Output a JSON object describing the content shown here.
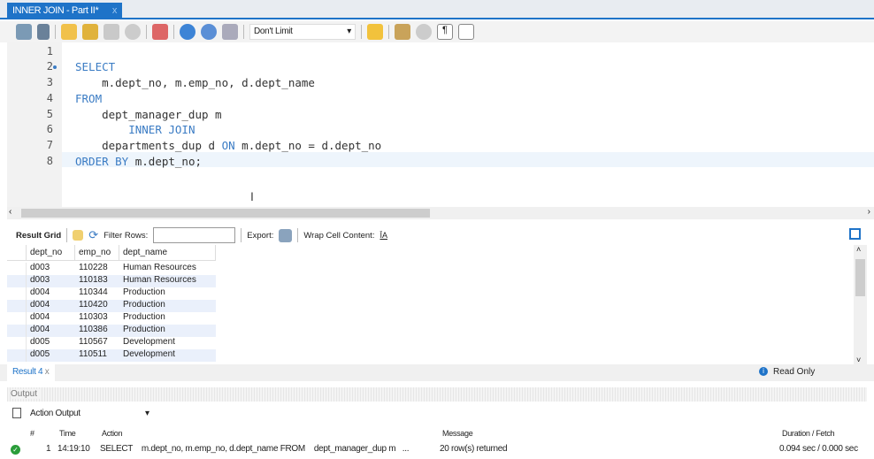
{
  "tab": {
    "title": "INNER JOIN - Part II*",
    "close": "x"
  },
  "toolbar": {
    "limit": "Don't Limit"
  },
  "editor": {
    "lines": [
      "1",
      "2",
      "3",
      "4",
      "5",
      "6",
      "7",
      "8"
    ]
  },
  "results": {
    "result_grid": "Result Grid",
    "filter_rows": "Filter Rows:",
    "export": "Export:",
    "wrap": "Wrap Cell Content:",
    "columns": [
      "dept_no",
      "emp_no",
      "dept_name"
    ],
    "rows": [
      [
        "d003",
        "110228",
        "Human Resources"
      ],
      [
        "d003",
        "110183",
        "Human Resources"
      ],
      [
        "d004",
        "110344",
        "Production"
      ],
      [
        "d004",
        "110420",
        "Production"
      ],
      [
        "d004",
        "110303",
        "Production"
      ],
      [
        "d004",
        "110386",
        "Production"
      ],
      [
        "d005",
        "110567",
        "Development"
      ],
      [
        "d005",
        "110511",
        "Development"
      ]
    ],
    "tab": "Result 4",
    "tab_close": "x",
    "read_only": "Read Only"
  },
  "output": {
    "title": "Output",
    "mode": "Action Output",
    "headers": {
      "num": "#",
      "time": "Time",
      "action": "Action",
      "message": "Message",
      "duration": "Duration / Fetch"
    },
    "row": {
      "num": "1",
      "time": "14:19:10",
      "action": "SELECT    m.dept_no, m.emp_no, d.dept_name FROM    dept_manager_dup m   ...",
      "message": "20 row(s) returned",
      "duration": "0.094 sec / 0.000 sec",
      "status": "success"
    }
  }
}
